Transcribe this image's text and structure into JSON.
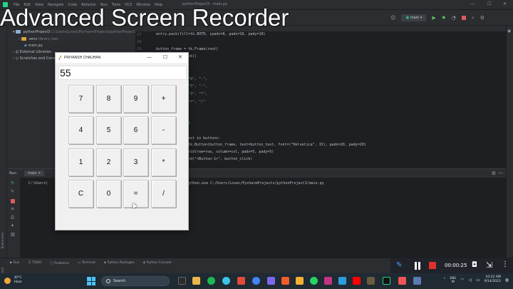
{
  "watermark": "Advanced Screen Recorder",
  "ide": {
    "menu": [
      "File",
      "Edit",
      "View",
      "Navigate",
      "Code",
      "Refactor",
      "Run",
      "Tools",
      "VCS",
      "Window",
      "Help"
    ],
    "title": "pythonProject3 - main.py",
    "run_config": "main",
    "project_tree": {
      "root": "pythonProject3",
      "root_path": "C:\\Users\\Lovec\\PycharmProjects\\pythonProject3",
      "venv": "venv",
      "venv_note": "library root",
      "file": "main.py",
      "external": "External Libraries",
      "scratches": "Scratches and Consoles"
    },
    "editor": {
      "line_numbers": [
        "27",
        "28",
        "29"
      ],
      "lines": [
        "entry.pack(fill=tk.BOTH, ipadx=8, padx=10, pady=10)",
        "",
        "button_frame = tk.Frame(root)",
        "button_frame.pack()",
        "",
        "\"8\", \"-\",",
        "\"5\", \"-\",",
        "\"3\", \"*\",",
        "\"=\", \"/\"",
        "",
        "0",
        "",
        "ext in buttons:",
        "tk.Button(button_frame, text=button_text, font=(\"Helvetica\", 15), padx=20, pady=20)",
        "rid(row=row, column=col, padx=5, pady=5)",
        "nd(\"<Button-1>\", button_click)"
      ]
    },
    "run_panel": {
      "label": "Run:",
      "tab": "main",
      "output_prefix": "C:\\Users\\",
      "output_suffix": "python.exe C:/Users/Lovec/PycharmProjects/pythonProject3/main.py"
    },
    "bottom_tabs": [
      "Run",
      "TODO",
      "Problems",
      "Terminal",
      "Python Packages",
      "Python Console"
    ]
  },
  "calculator": {
    "title": "PRIYANSH CHAUHAN",
    "display": "55",
    "buttons": [
      [
        "7",
        "8",
        "9",
        "+"
      ],
      [
        "4",
        "5",
        "6",
        "-"
      ],
      [
        "1",
        "2",
        "3",
        "*"
      ],
      [
        "C",
        "0",
        "=",
        "/"
      ]
    ]
  },
  "recorder": {
    "elapsed": "00:00:25"
  },
  "taskbar": {
    "weather_temp": "30°C",
    "weather_desc": "Haze",
    "search_label": "Search",
    "lang_top": "ENG",
    "lang_bottom": "IN",
    "time": "10:22 AM",
    "date": "9/14/2023"
  }
}
